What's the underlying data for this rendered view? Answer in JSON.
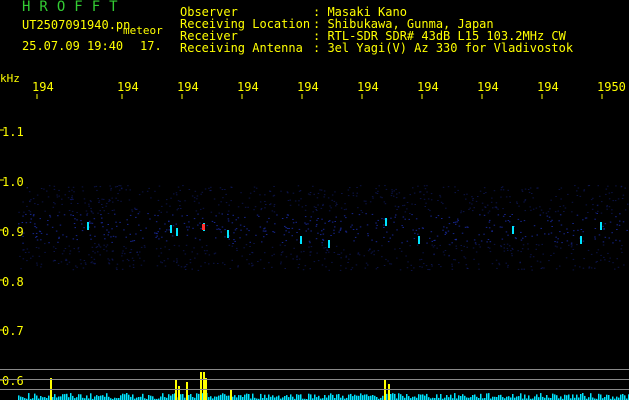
{
  "header": {
    "logo": "HROFFT",
    "filename": "UT2507091940.pn",
    "event_label": "meteor",
    "timestamp": "25.07.09 19:40",
    "count": "17."
  },
  "info": [
    {
      "label": "Observer",
      "value": ": Masaki Kano"
    },
    {
      "label": "Receiving Location",
      "value": ": Shibukawa, Gunma, Japan"
    },
    {
      "label": "Receiver",
      "value": ": RTL-SDR SDR# 43dB L15 103.2MHz CW"
    },
    {
      "label": "Receiving Antenna",
      "value": ": 3el Yagi(V) Az 330 for Vladivostok"
    }
  ],
  "axis": {
    "unit": "kHz",
    "time_ticks": [
      "194",
      "194",
      "194",
      "194",
      "194",
      "194",
      "194",
      "194",
      "194",
      "1950"
    ],
    "freq_ticks": [
      "1.1",
      "1.0",
      "0.9",
      "0.8",
      "0.7",
      "0.6"
    ]
  },
  "colors": {
    "text": "#ffff00",
    "logo": "#33cc33",
    "background": "#000000",
    "band_noise": "#1a2aa0",
    "signal": "#00e5ff",
    "peak": "#ff3030",
    "meter_level": "#00e5ff",
    "meter_peak": "#ffff00",
    "gridline": "#8a8a8a"
  }
}
